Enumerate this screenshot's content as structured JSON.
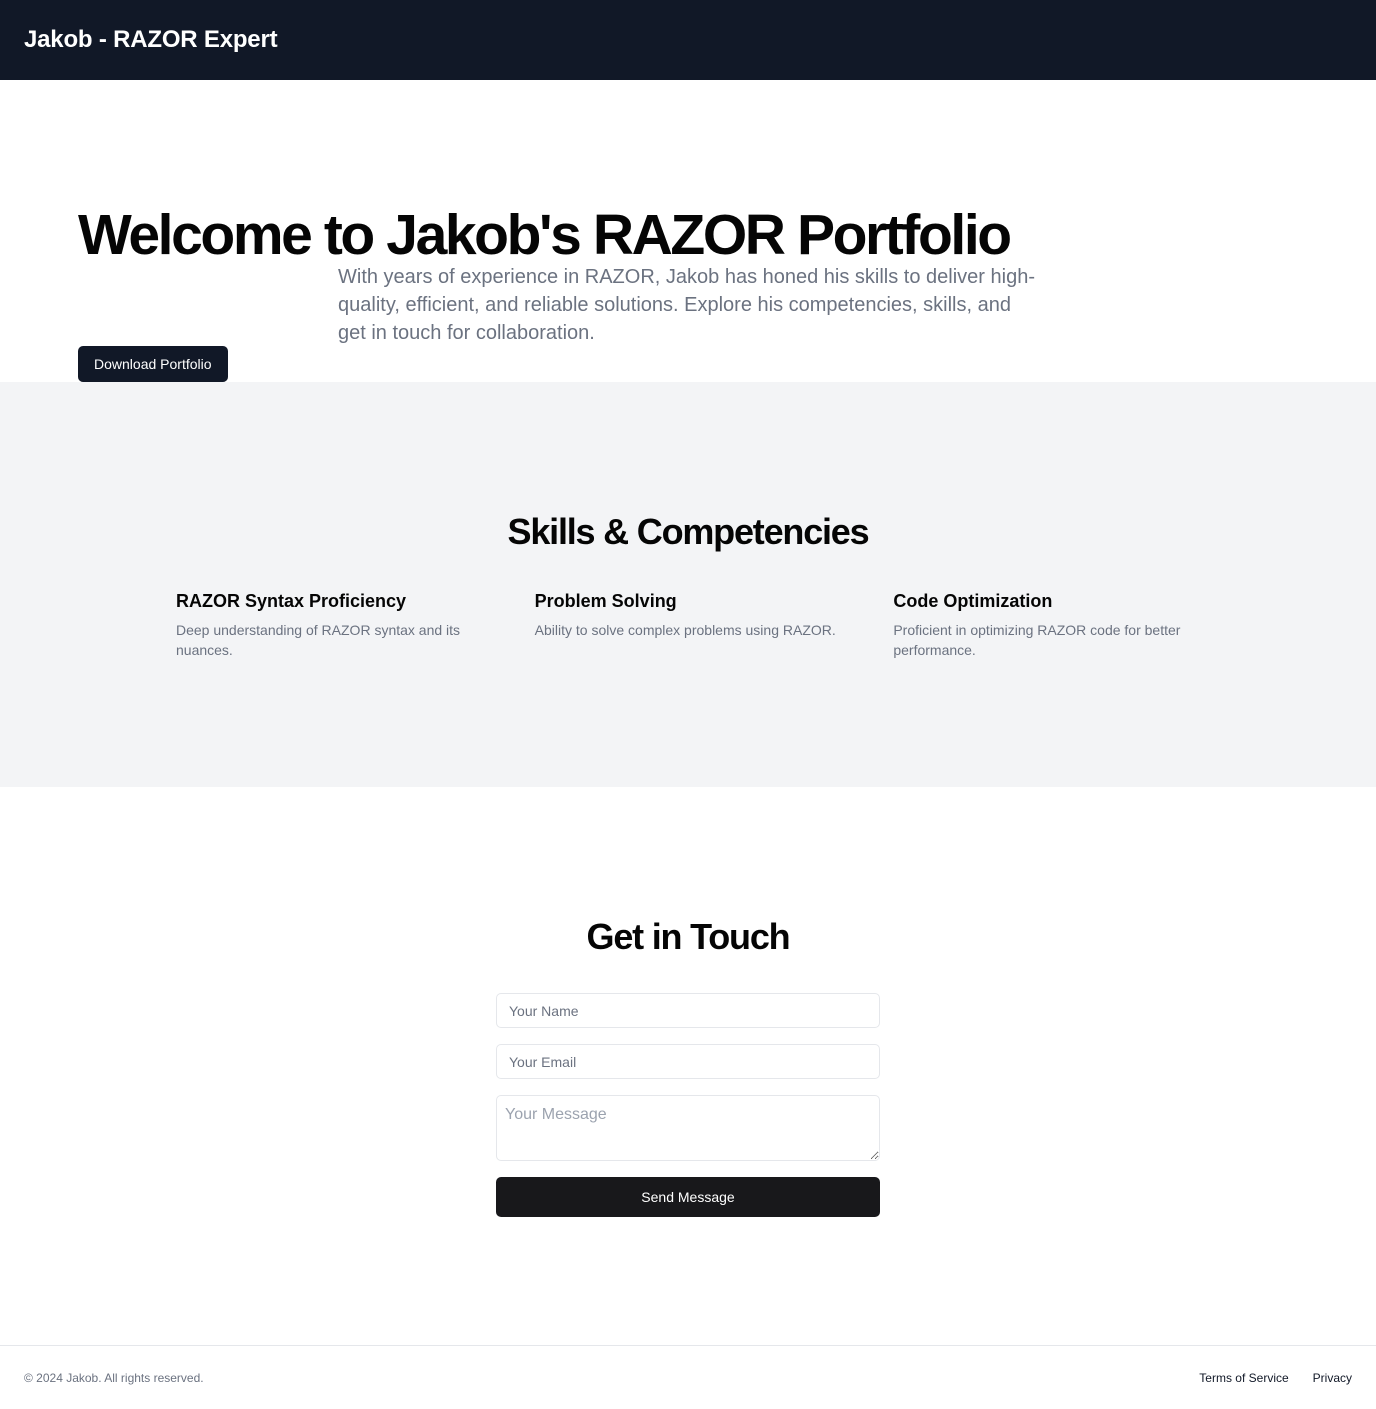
{
  "header": {
    "brand": "Jakob - RAZOR Expert"
  },
  "hero": {
    "title": "Welcome to Jakob's RAZOR Portfolio",
    "description": "With years of experience in RAZOR, Jakob has honed his skills to deliver high-quality, efficient, and reliable solutions. Explore his competencies, skills, and get in touch for collaboration.",
    "button_label": "Download Portfolio"
  },
  "skills": {
    "title": "Skills & Competencies",
    "items": [
      {
        "title": "RAZOR Syntax Proficiency",
        "description": "Deep understanding of RAZOR syntax and its nuances."
      },
      {
        "title": "Problem Solving",
        "description": "Ability to solve complex problems using RAZOR."
      },
      {
        "title": "Code Optimization",
        "description": "Proficient in optimizing RAZOR code for better performance."
      }
    ]
  },
  "contact": {
    "title": "Get in Touch",
    "name_placeholder": "Your Name",
    "email_placeholder": "Your Email",
    "message_placeholder": "Your Message",
    "send_label": "Send Message"
  },
  "footer": {
    "copyright": "© 2024 Jakob. All rights reserved.",
    "links": [
      "Terms of Service",
      "Privacy"
    ]
  },
  "colors": {
    "header_bg": "#111827",
    "skills_bg": "#f3f4f6",
    "button_dark": "#18181b",
    "muted_text": "#6b7280"
  }
}
